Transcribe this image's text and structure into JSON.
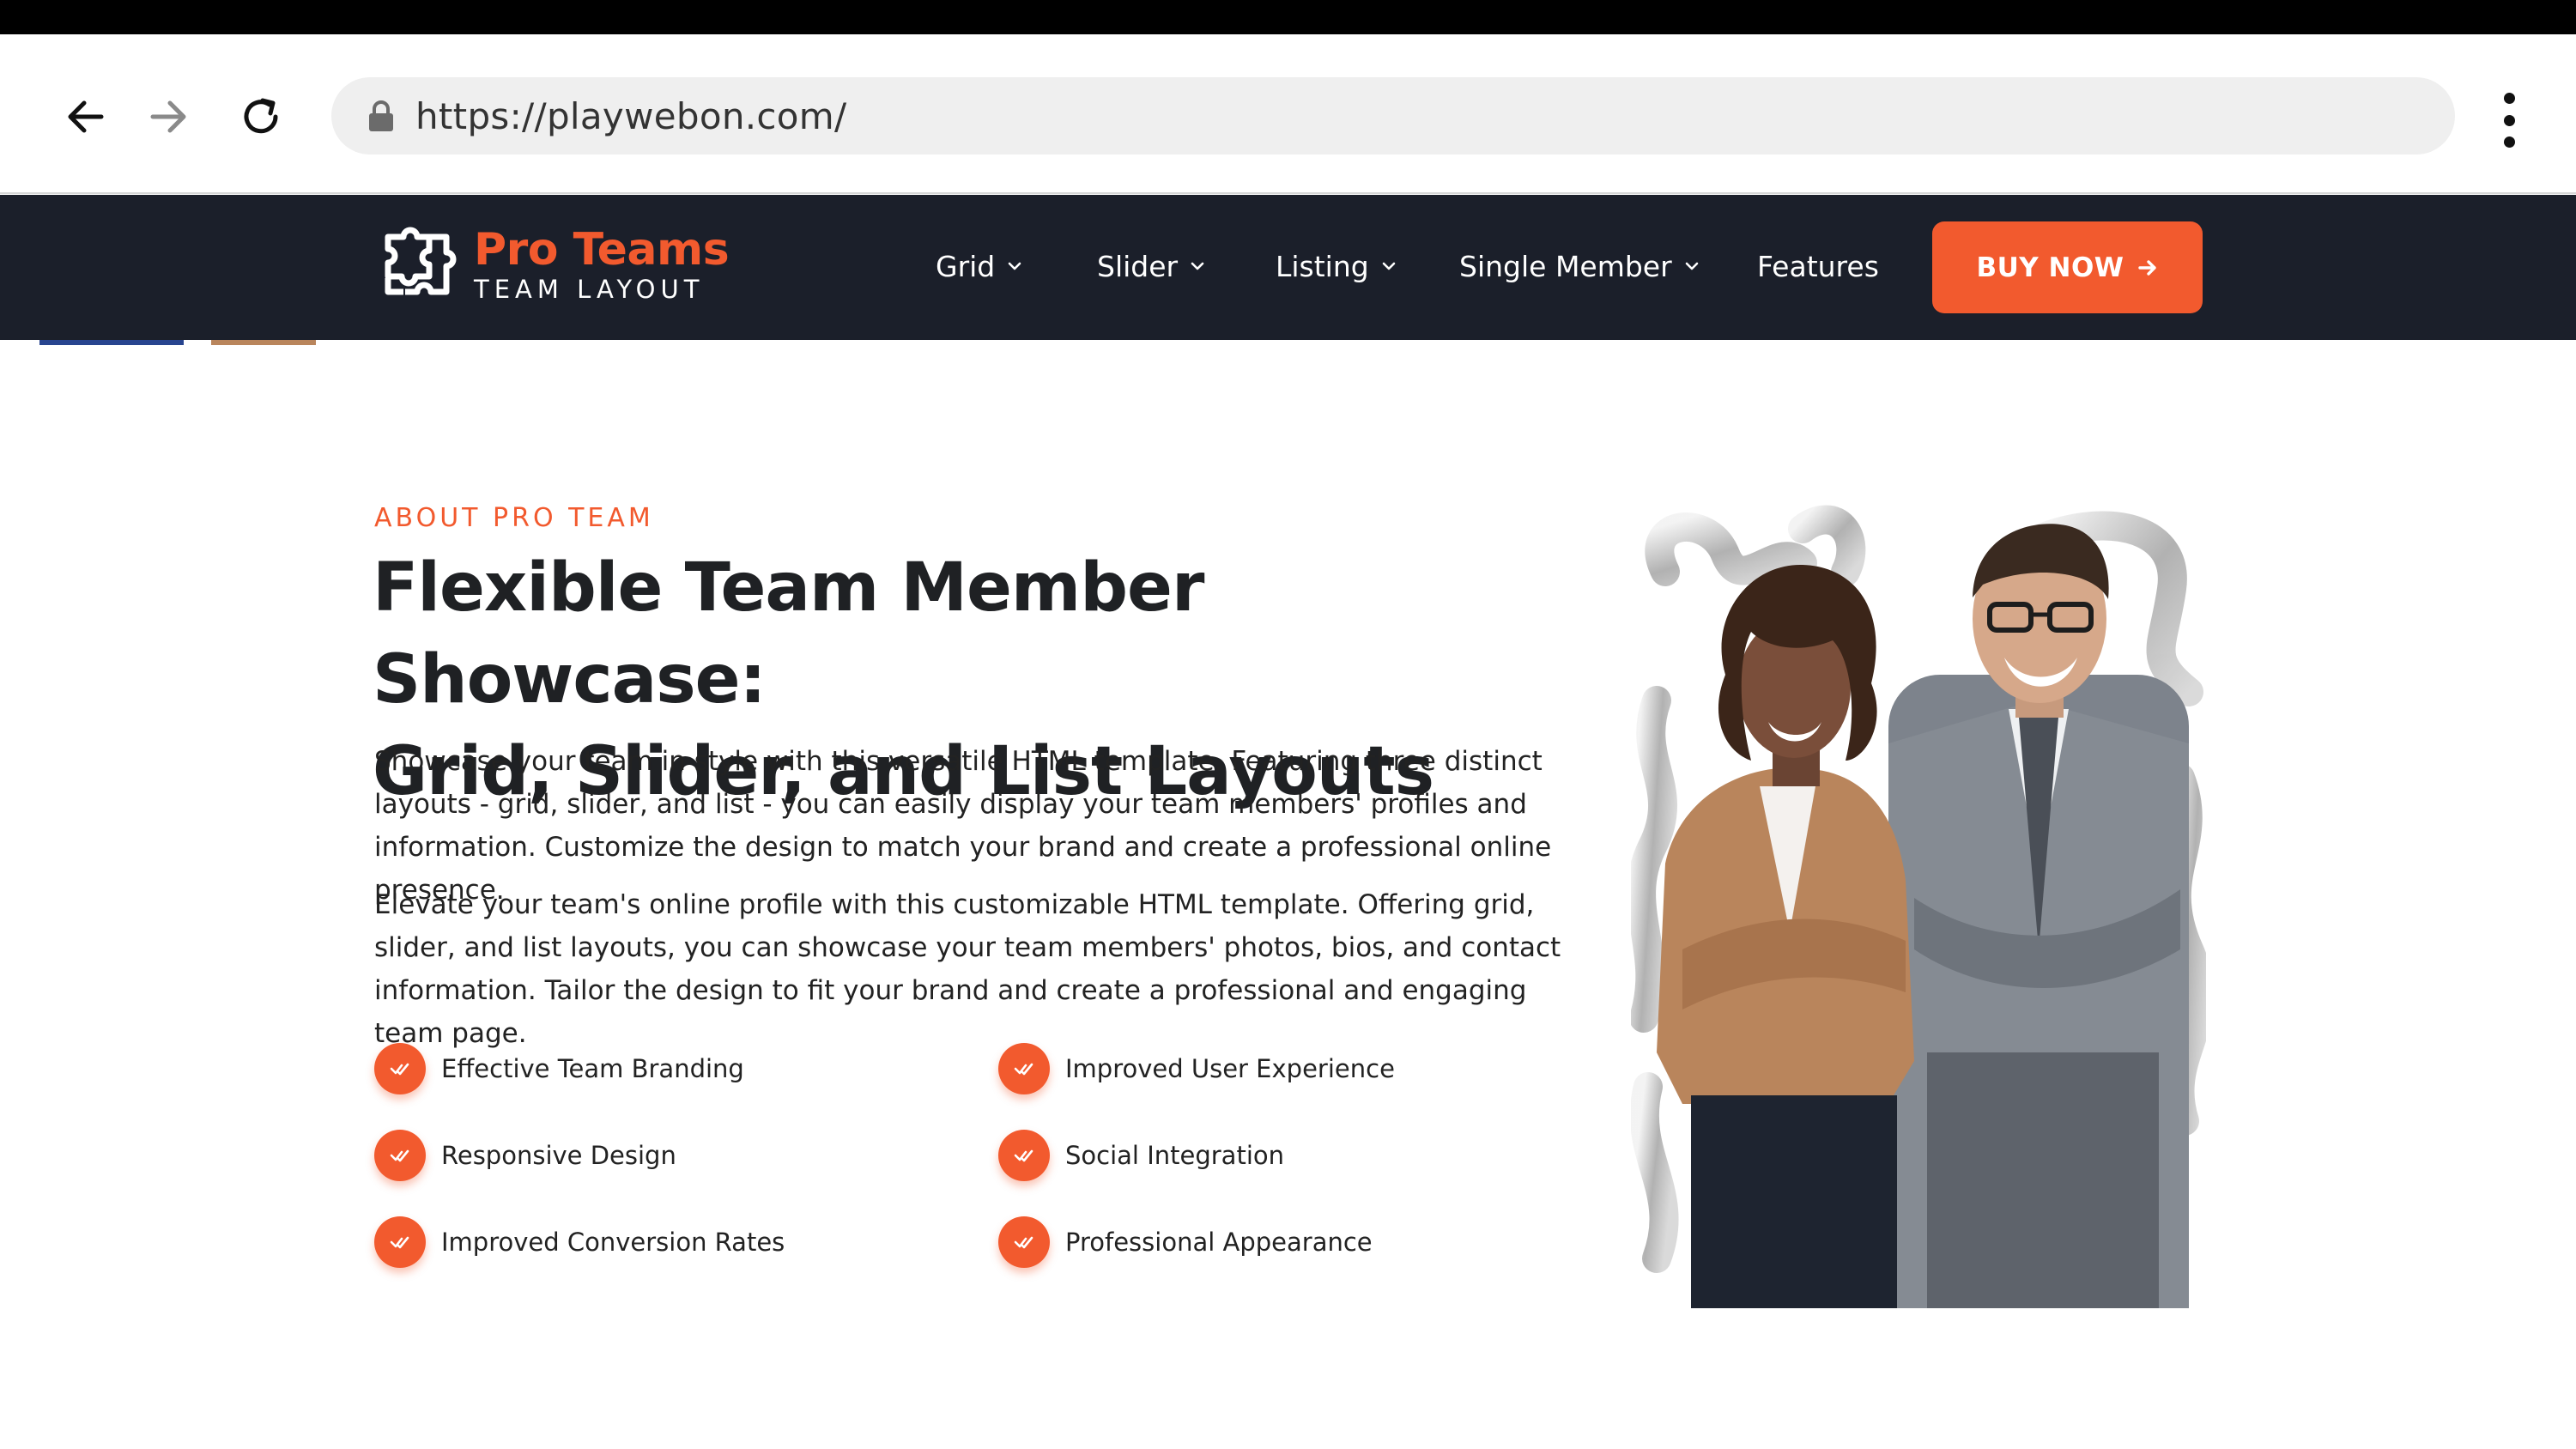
{
  "browser": {
    "url": "https://playwebon.com/"
  },
  "header": {
    "logo": {
      "title": "Pro Teams",
      "subtitle": "TEAM LAYOUT"
    },
    "nav": [
      {
        "label": "Grid",
        "has_dropdown": true
      },
      {
        "label": "Slider",
        "has_dropdown": true
      },
      {
        "label": "Listing",
        "has_dropdown": true
      },
      {
        "label": "Single Member",
        "has_dropdown": true
      },
      {
        "label": "Features",
        "has_dropdown": false
      }
    ],
    "cta_label": "BUY NOW"
  },
  "about": {
    "eyebrow": "ABOUT PRO TEAM",
    "headline_line1": "Flexible Team Member Showcase:",
    "headline_line2": "Grid, Slider, and List Layouts",
    "paragraph1": "Showcase your team in style with this versatile HTML template. Featuring three distinct layouts - grid, slider, and list - you can easily display your team members' profiles and information. Customize the design to match your brand and create a professional online presence.",
    "paragraph2": "Elevate your team's online profile with this customizable HTML template. Offering grid, slider, and list layouts, you can showcase your team members' photos, bios, and contact information. Tailor the design to fit your brand and create a professional and engaging team page.",
    "features": [
      "Effective Team Branding",
      "Improved User Experience",
      "Responsive Design",
      "Social Integration",
      "Improved Conversion Rates",
      "Professional Appearance"
    ]
  },
  "colors": {
    "accent": "#f25a2e",
    "header_bg": "#1b1f2a",
    "heading_text": "#1f2124"
  }
}
